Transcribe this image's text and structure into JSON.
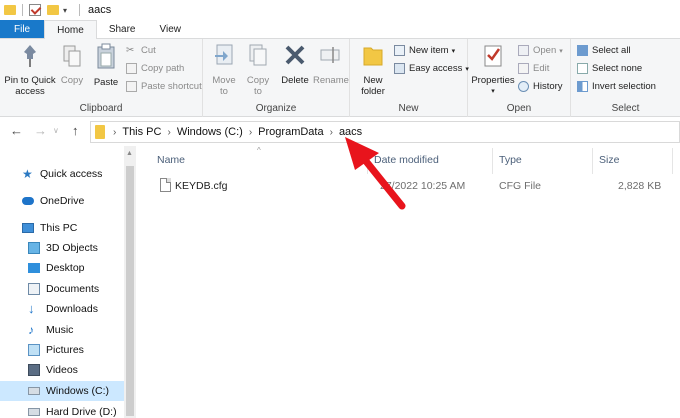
{
  "window": {
    "title": "aacs"
  },
  "tabs": [
    {
      "label": "File"
    },
    {
      "label": "Home"
    },
    {
      "label": "Share"
    },
    {
      "label": "View"
    }
  ],
  "ribbon": {
    "clipboard": {
      "label": "Clipboard",
      "pin": "Pin to Quick access",
      "copy": "Copy",
      "paste": "Paste",
      "cut": "Cut",
      "copy_path": "Copy path",
      "paste_shortcut": "Paste shortcut"
    },
    "organize": {
      "label": "Organize",
      "move_to": "Move to",
      "copy_to": "Copy to",
      "delete": "Delete",
      "rename": "Rename"
    },
    "new": {
      "label": "New",
      "new_folder": "New folder",
      "new_item": "New item",
      "easy_access": "Easy access"
    },
    "open": {
      "label": "Open",
      "properties": "Properties",
      "open": "Open",
      "edit": "Edit",
      "history": "History"
    },
    "select": {
      "label": "Select",
      "select_all": "Select all",
      "select_none": "Select none",
      "invert": "Invert selection"
    }
  },
  "address": {
    "crumbs": [
      "This PC",
      "Windows (C:)",
      "ProgramData",
      "aacs"
    ]
  },
  "nav": {
    "items": [
      {
        "label": "Quick access",
        "icon": "star-icon"
      },
      {
        "label": "OneDrive",
        "icon": "cloud-icon"
      },
      {
        "label": "This PC",
        "icon": "computer-icon"
      },
      {
        "label": "3D Objects",
        "icon": "cube-icon"
      },
      {
        "label": "Desktop",
        "icon": "desktop-icon"
      },
      {
        "label": "Documents",
        "icon": "document-icon"
      },
      {
        "label": "Downloads",
        "icon": "download-icon"
      },
      {
        "label": "Music",
        "icon": "music-icon"
      },
      {
        "label": "Pictures",
        "icon": "picture-icon"
      },
      {
        "label": "Videos",
        "icon": "video-icon"
      },
      {
        "label": "Windows (C:)",
        "icon": "drive-icon"
      },
      {
        "label": "Hard Drive (D:)",
        "icon": "drive-icon"
      }
    ]
  },
  "columns": {
    "name": "Name",
    "date": "Date modified",
    "type": "Type",
    "size": "Size"
  },
  "files": [
    {
      "name": "KEYDB.cfg",
      "date": "27/2022 10:25 AM",
      "type": "CFG File",
      "size": "2,828 KB"
    }
  ],
  "colors": {
    "accent": "#1979ca",
    "selection": "#cce8ff",
    "annotation_arrow": "#e8141c"
  }
}
